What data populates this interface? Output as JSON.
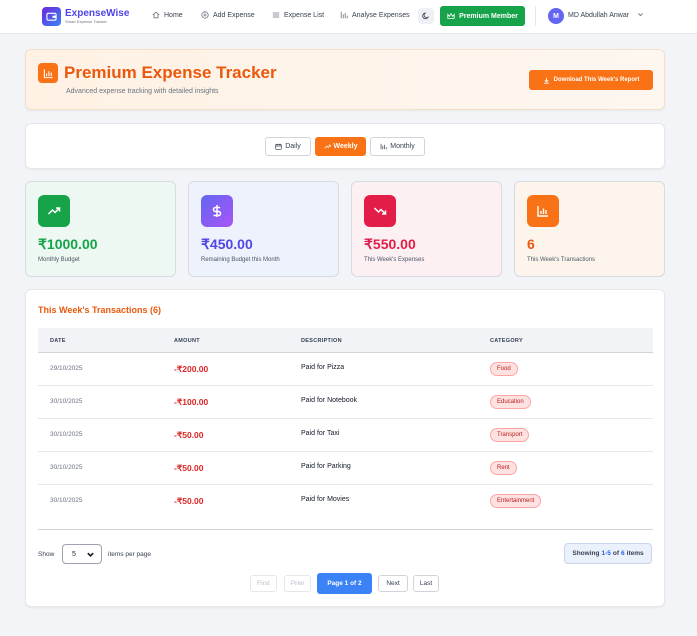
{
  "nav": {
    "brand": "ExpenseWise",
    "brand_sub": "Smart Expense Tracker",
    "links": [
      {
        "label": "Home",
        "icon": "home-icon"
      },
      {
        "label": "Add Expense",
        "icon": "plus-circle-icon"
      },
      {
        "label": "Expense List",
        "icon": "list-icon"
      },
      {
        "label": "Analyse Expenses",
        "icon": "bar-chart-icon"
      }
    ],
    "theme_icon": "moon-icon",
    "premium_label": "Premium Member",
    "avatar_letter": "M",
    "username": "MD Abdullah Anwar"
  },
  "hero": {
    "title": "Premium Expense Tracker",
    "subtitle": "Advanced expense tracking with detailed insights",
    "download_label": "Download This Week's Report"
  },
  "period": {
    "options": [
      "Daily",
      "Weekly",
      "Monthly"
    ],
    "selected": "Weekly"
  },
  "stats": [
    {
      "value": "₹1000.00",
      "label": "Monthly Budget",
      "icon": "trending-up-icon",
      "color": "#16a34a"
    },
    {
      "value": "₹450.00",
      "label": "Remaining Budget this Month",
      "icon": "dollar-icon",
      "color": "#4f46e5"
    },
    {
      "value": "₹550.00",
      "label": "This Week's Expenses",
      "icon": "trending-down-icon",
      "color": "#e11d48"
    },
    {
      "value": "6",
      "label": "This Week's Transactions",
      "icon": "bar-chart-icon",
      "color": "#ea580c"
    }
  ],
  "table": {
    "title": "This Week's Transactions (6)",
    "headers": [
      "DATE",
      "AMOUNT",
      "DESCRIPTION",
      "CATEGORY"
    ],
    "rows": [
      {
        "date": "29/10/2025",
        "amount": "-₹200.00",
        "description": "Paid for Pizza",
        "category": "Food"
      },
      {
        "date": "30/10/2025",
        "amount": "-₹100.00",
        "description": "Paid for Notebook",
        "category": "Education"
      },
      {
        "date": "30/10/2025",
        "amount": "-₹50.00",
        "description": "Paid for Taxi",
        "category": "Transport"
      },
      {
        "date": "30/10/2025",
        "amount": "-₹50.00",
        "description": "Paid for Parking",
        "category": "Rent"
      },
      {
        "date": "30/10/2025",
        "amount": "-₹50.00",
        "description": "Paid for Movies",
        "category": "Entertainment"
      }
    ]
  },
  "pagination": {
    "show_label": "Show",
    "per_page_value": "5",
    "per_page_label": "items per page",
    "showing_prefix": "Showing",
    "showing_range": "1-5",
    "showing_of": "of",
    "showing_total": "6",
    "showing_suffix": "items",
    "first": "First",
    "prev": "Prev",
    "current": "Page 1 of 2",
    "next": "Next",
    "last": "Last"
  }
}
